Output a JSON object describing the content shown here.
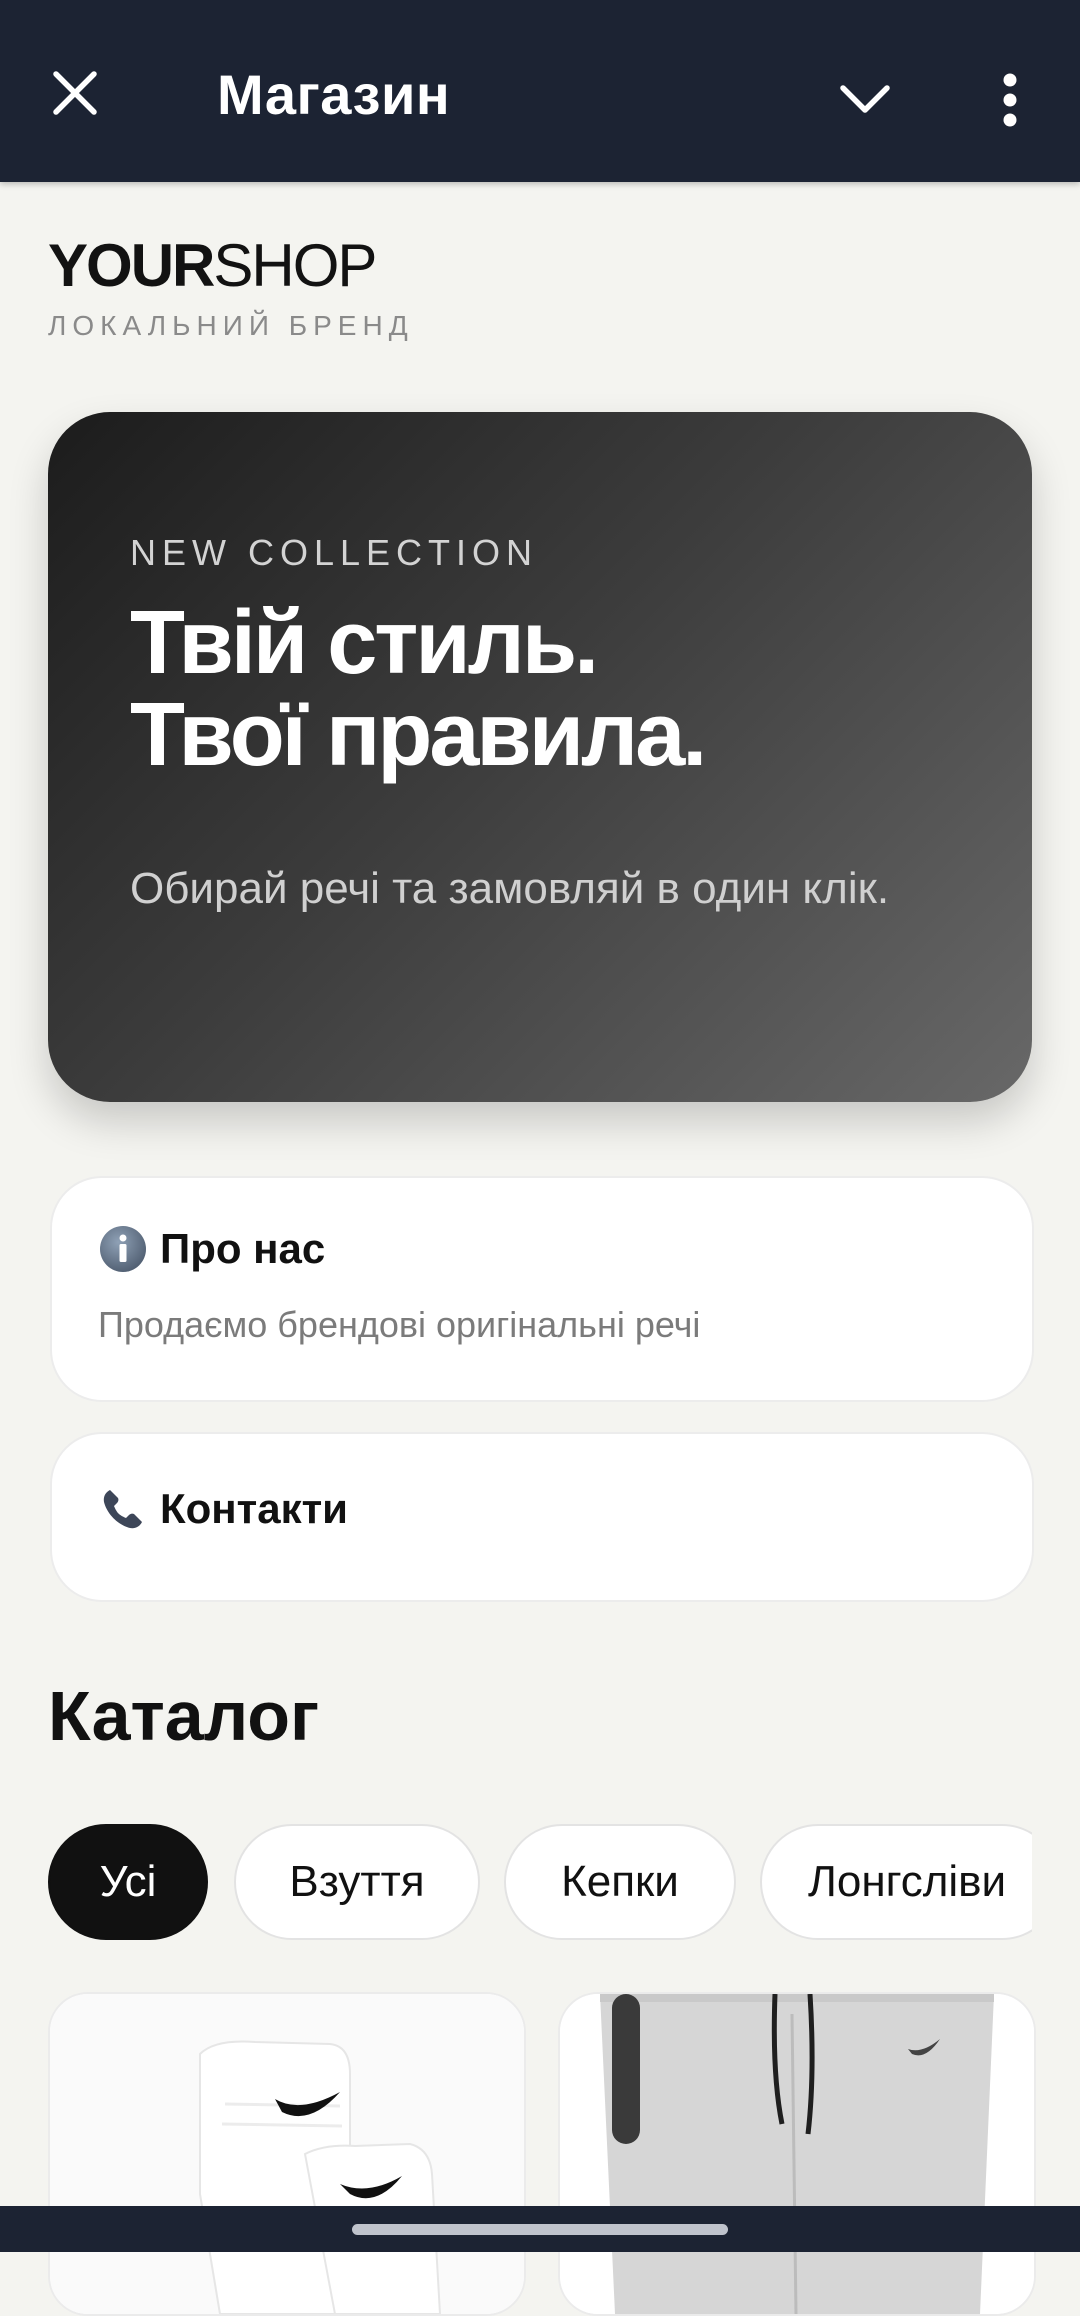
{
  "topbar": {
    "title": "Магазин",
    "close_icon": "close-icon",
    "dropdown_icon": "chevron-down-icon",
    "menu_icon": "more-vertical-icon",
    "background": "#1c2333"
  },
  "brand": {
    "logo_bold": "YOUR",
    "logo_regular": "SHOP",
    "tagline": "ЛОКАЛЬНИЙ БРЕНД"
  },
  "hero": {
    "kicker": "NEW COLLECTION",
    "headline_line1": "Твій стиль.",
    "headline_line2": "Твої правила.",
    "description": "Обирай речі та замовляй в один клік."
  },
  "about": {
    "icon": "info-icon",
    "title": "Про нас",
    "text": "Продаємо брендові оригінальні речі"
  },
  "contacts": {
    "icon": "phone-icon",
    "title": "Контакти"
  },
  "catalog": {
    "title": "Каталог",
    "chips": [
      {
        "label": "Усі",
        "active": true
      },
      {
        "label": "Взуття",
        "active": false
      },
      {
        "label": "Кепки",
        "active": false
      },
      {
        "label": "Лонгсліви",
        "active": false
      }
    ],
    "products": [
      {
        "image": "white-socks-image"
      },
      {
        "image": "grey-pants-image"
      }
    ]
  }
}
